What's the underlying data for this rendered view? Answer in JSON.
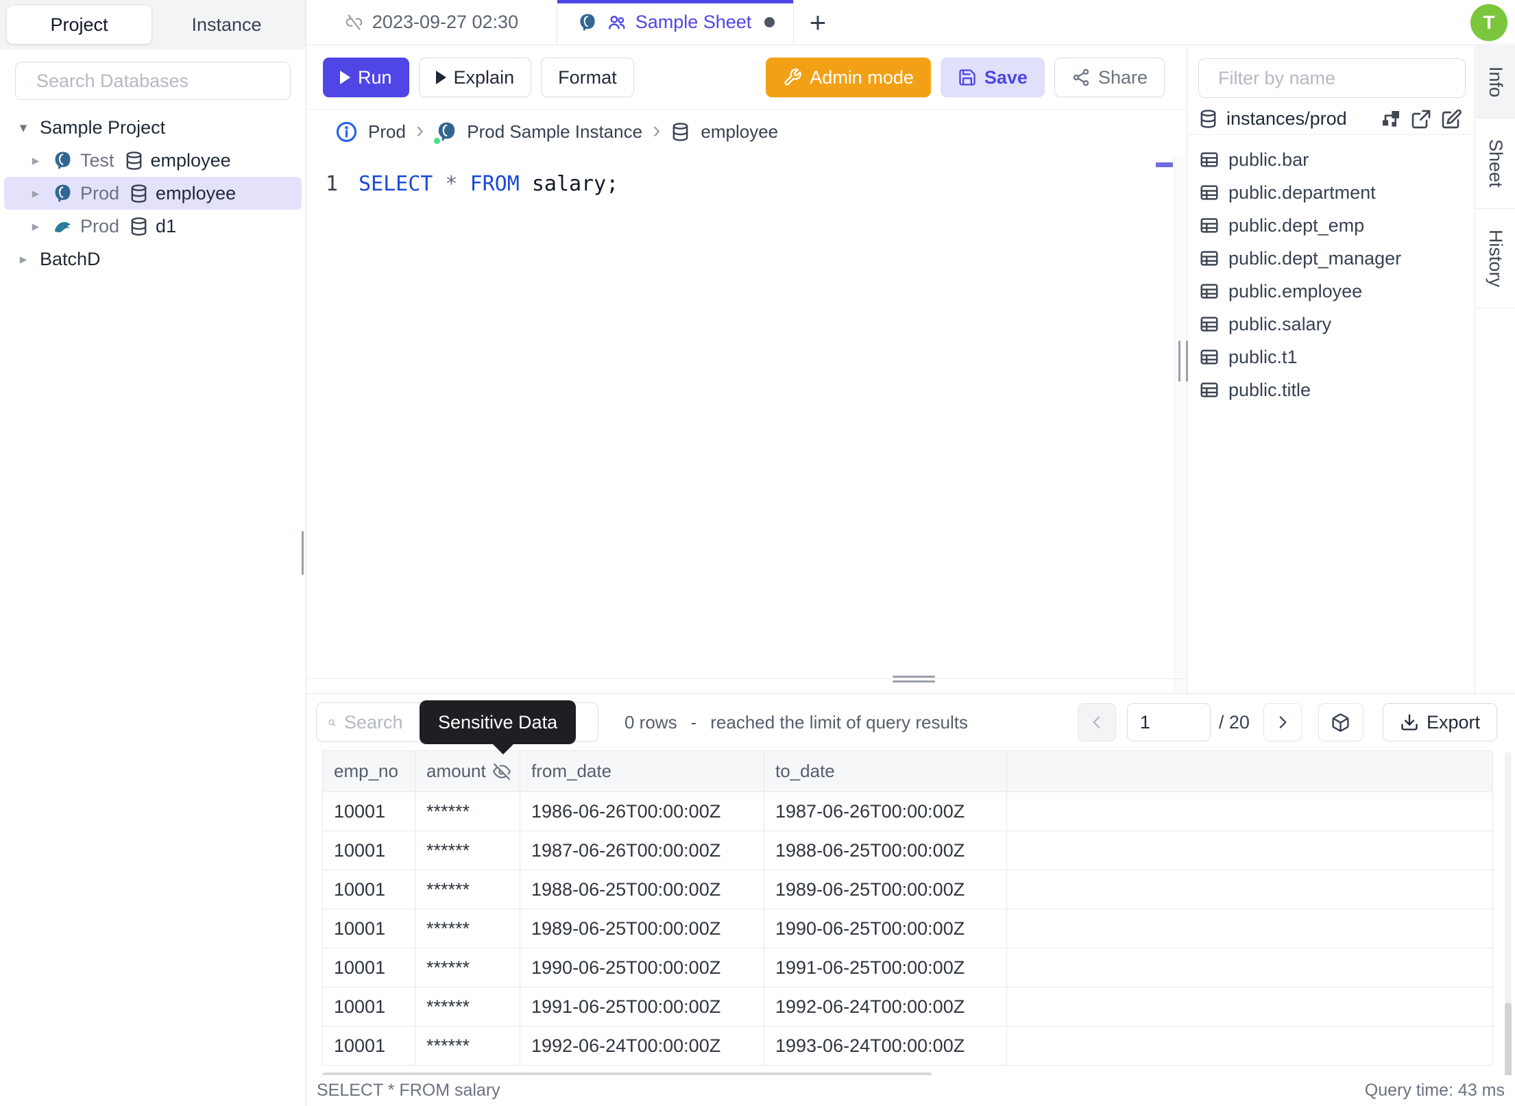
{
  "colors": {
    "accent": "#4f46e5",
    "accent-soft": "#e4e2fb",
    "admin-orange": "#f2a117",
    "avatar-green": "#7cc63e",
    "tooltip": "#1d1f23",
    "kw-blue": "#1b49d8"
  },
  "sidebar": {
    "tabs": [
      {
        "label": "Project"
      },
      {
        "label": "Instance"
      }
    ],
    "search_placeholder": "Search Databases",
    "tree": {
      "root": "Sample Project",
      "items": [
        {
          "env": "Test",
          "db": "employee",
          "engine": "postgres"
        },
        {
          "env": "Prod",
          "db": "employee",
          "engine": "postgres"
        },
        {
          "env": "Prod",
          "db": "d1",
          "engine": "mysql"
        }
      ],
      "root2": "BatchD"
    }
  },
  "tabbar": {
    "tab1": "2023-09-27 02:30",
    "tab2": "Sample Sheet",
    "new_tab": "+",
    "avatar_initial": "T"
  },
  "toolbar": {
    "run": "Run",
    "explain": "Explain",
    "format": "Format",
    "admin_mode": "Admin mode",
    "save": "Save",
    "share": "Share"
  },
  "breadcrumb": {
    "env": "Prod",
    "instance": "Prod Sample Instance",
    "database": "employee"
  },
  "editor": {
    "line_number": "1",
    "kw1": "SELECT",
    "star": " * ",
    "kw2": "FROM",
    "tail": " salary;"
  },
  "schema_panel": {
    "filter_placeholder": "Filter by name",
    "database_path": "instances/prod",
    "tables": [
      "public.bar",
      "public.department",
      "public.dept_emp",
      "public.dept_manager",
      "public.employee",
      "public.salary",
      "public.t1",
      "public.title"
    ]
  },
  "side_tabs": [
    "Info",
    "Sheet",
    "History"
  ],
  "results": {
    "search_placeholder": "Search",
    "tooltip": "Sensitive Data",
    "row_count": "0 rows",
    "separator": "-",
    "limit_message": "reached the limit of query results",
    "page_current": "1",
    "page_total": "/ 20",
    "export_label": "Export",
    "status_query": "SELECT * FROM salary",
    "status_time": "Query time: 43 ms",
    "table": {
      "columns": [
        "emp_no",
        "amount",
        "from_date",
        "to_date"
      ],
      "masked_column": "amount",
      "rows": [
        [
          "10001",
          "******",
          "1986-06-26T00:00:00Z",
          "1987-06-26T00:00:00Z"
        ],
        [
          "10001",
          "******",
          "1987-06-26T00:00:00Z",
          "1988-06-25T00:00:00Z"
        ],
        [
          "10001",
          "******",
          "1988-06-25T00:00:00Z",
          "1989-06-25T00:00:00Z"
        ],
        [
          "10001",
          "******",
          "1989-06-25T00:00:00Z",
          "1990-06-25T00:00:00Z"
        ],
        [
          "10001",
          "******",
          "1990-06-25T00:00:00Z",
          "1991-06-25T00:00:00Z"
        ],
        [
          "10001",
          "******",
          "1991-06-25T00:00:00Z",
          "1992-06-24T00:00:00Z"
        ],
        [
          "10001",
          "******",
          "1992-06-24T00:00:00Z",
          "1993-06-24T00:00:00Z"
        ]
      ]
    }
  }
}
